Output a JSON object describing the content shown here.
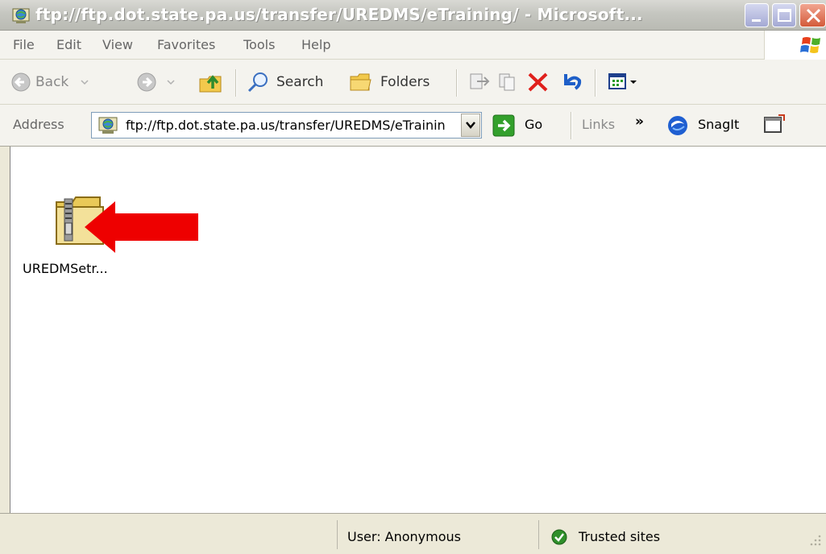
{
  "window": {
    "title": "ftp://ftp.dot.state.pa.us/transfer/UREDMS/eTraining/ - Microsoft...",
    "title_icon": "ftp-globe-icon"
  },
  "menu": {
    "items": [
      "File",
      "Edit",
      "View",
      "Favorites",
      "Tools",
      "Help"
    ]
  },
  "toolbar": {
    "back_label": "Back",
    "search_label": "Search",
    "folders_label": "Folders"
  },
  "address": {
    "label": "Address",
    "value": "ftp://ftp.dot.state.pa.us/transfer/UREDMS/eTraining/",
    "go_label": "Go",
    "links_label": "Links",
    "chevron": "»",
    "snagit_label": "SnagIt"
  },
  "content": {
    "files": [
      {
        "name": "UREDMSetr...",
        "icon": "zip-folder-icon"
      }
    ]
  },
  "status": {
    "user": "User: Anonymous",
    "zone": "Trusted sites"
  },
  "colors": {
    "arrow": "#ee0000",
    "titlebar": "#c5c6c0",
    "chrome": "#ece9d8"
  }
}
